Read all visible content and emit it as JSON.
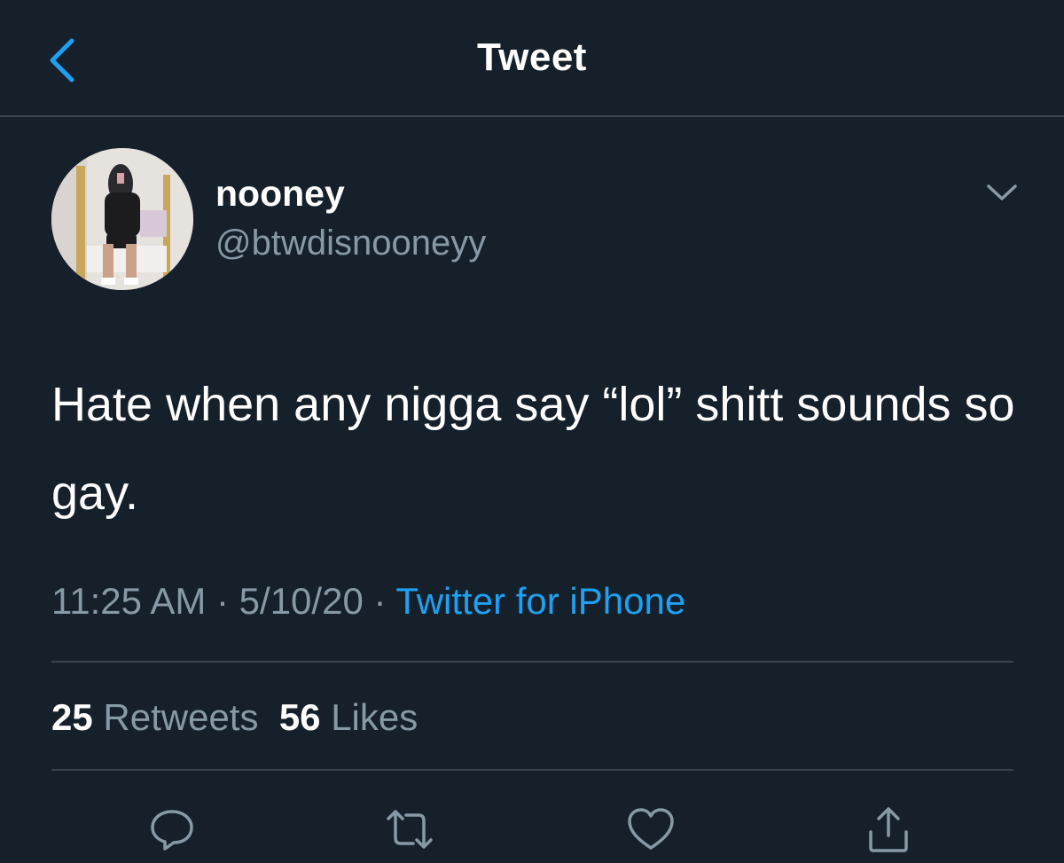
{
  "header": {
    "title": "Tweet",
    "back_icon": "chevron-left-icon"
  },
  "colors": {
    "background": "#15202b",
    "accent": "#1da1f2",
    "secondary_text": "#8899a6",
    "divider": "#38444d"
  },
  "author": {
    "display_name": "nooney",
    "handle": "@btwdisnooneyy"
  },
  "tweet": {
    "text": "Hate when any nigga say “lol” shitt sounds so gay."
  },
  "meta": {
    "time": "11:25 AM",
    "separator": " · ",
    "date": "5/10/20",
    "source": "Twitter for iPhone"
  },
  "stats": {
    "retweets_count": "25",
    "retweets_label": "Retweets",
    "likes_count": "56",
    "likes_label": "Likes"
  },
  "actions": [
    {
      "name": "reply",
      "icon": "reply-icon"
    },
    {
      "name": "retweet",
      "icon": "retweet-icon"
    },
    {
      "name": "like",
      "icon": "heart-icon"
    },
    {
      "name": "share",
      "icon": "share-icon"
    }
  ]
}
